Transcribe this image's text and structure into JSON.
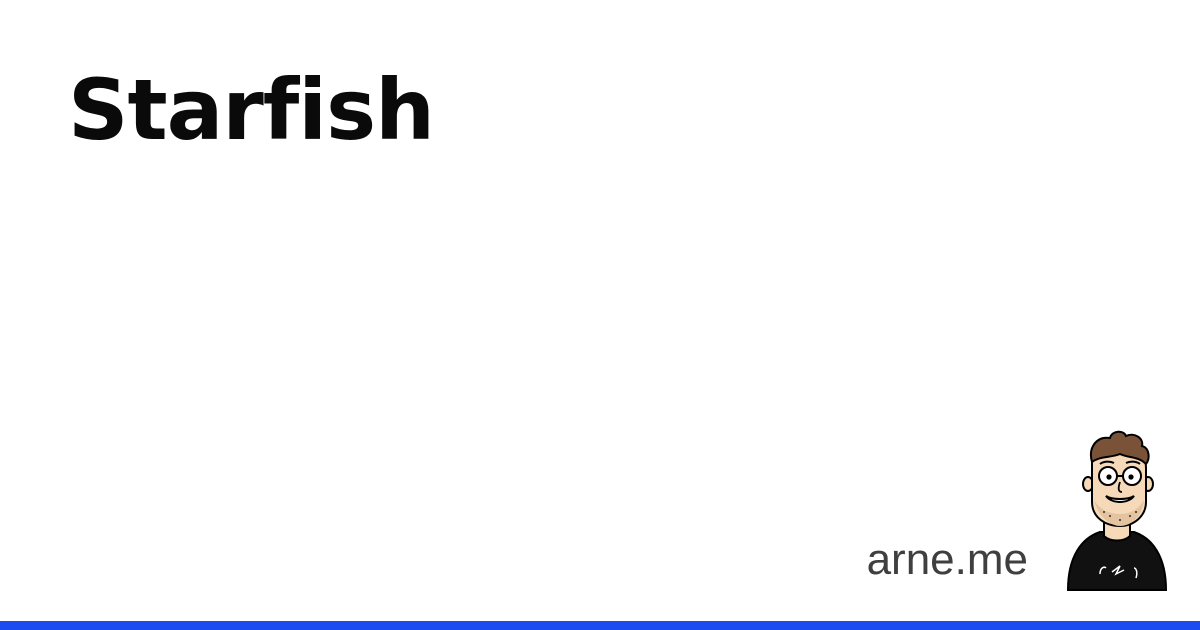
{
  "post": {
    "title": "Starfish"
  },
  "site": {
    "name": "arne.me"
  },
  "avatar": {
    "icon": "cartoon-avatar-icon"
  },
  "colors": {
    "background": "#ffffff",
    "title": "#0a0a0a",
    "site_name": "#3f3f3f",
    "accent_bar": "#1a4cf2",
    "hair": "#7a5238",
    "skin": "#f5d9b8",
    "shirt": "#111111"
  }
}
